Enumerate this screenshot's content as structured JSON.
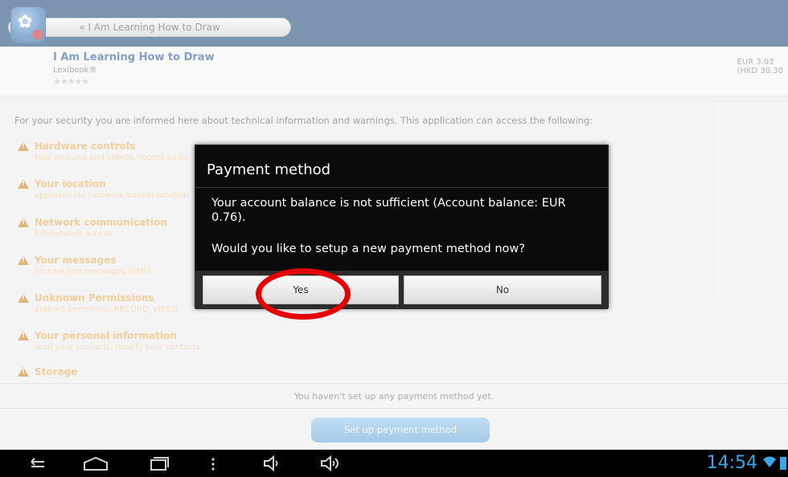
{
  "header": {
    "back_label": "« I Am Learning How to Draw"
  },
  "app": {
    "title": "I Am Learning How to Draw",
    "developer": "Lexibook®",
    "stars": "★★★★★",
    "price_eur": "EUR 3.03",
    "price_hkd": "(HKD 30.30"
  },
  "intro_text": "For your security you are informed here about technical information and warnings. This application can access the following:",
  "permissions": [
    {
      "title": "Hardware controls",
      "desc": "take pictures and videos, record audio"
    },
    {
      "title": "Your location",
      "desc": "approximate (network-based) location"
    },
    {
      "title": "Network communication",
      "desc": "full network access"
    },
    {
      "title": "Your messages",
      "desc": "receive text messages (SMS)"
    },
    {
      "title": "Unknown Permissions",
      "desc": "android.permission.RECORD_VIDEO"
    },
    {
      "title": "Your personal information",
      "desc": "read your contacts, modify your contacts"
    },
    {
      "title": "Storage",
      "desc": ""
    }
  ],
  "bottom": {
    "no_payment_msg": "You haven't set up any payment method yet.",
    "setup_button": "Set up payment method"
  },
  "dialog": {
    "title": "Payment method",
    "message1": "Your account balance is not sufficient (Account balance: EUR 0.76).",
    "message2": "Would you like to setup a new payment method now?",
    "yes_label": "Yes",
    "no_label": "No"
  },
  "statusbar": {
    "time": "14:54"
  },
  "colors": {
    "header_bg": "#0f3d6e",
    "permission_title": "#e8a64b",
    "highlight_ring": "#e60000",
    "clock": "#3aa8e8"
  },
  "icons": [
    "back-icon",
    "home-icon",
    "recent-apps-icon",
    "menu-icon",
    "volume-down-icon",
    "volume-up-icon",
    "wifi-icon",
    "battery-icon",
    "warning-icon"
  ]
}
